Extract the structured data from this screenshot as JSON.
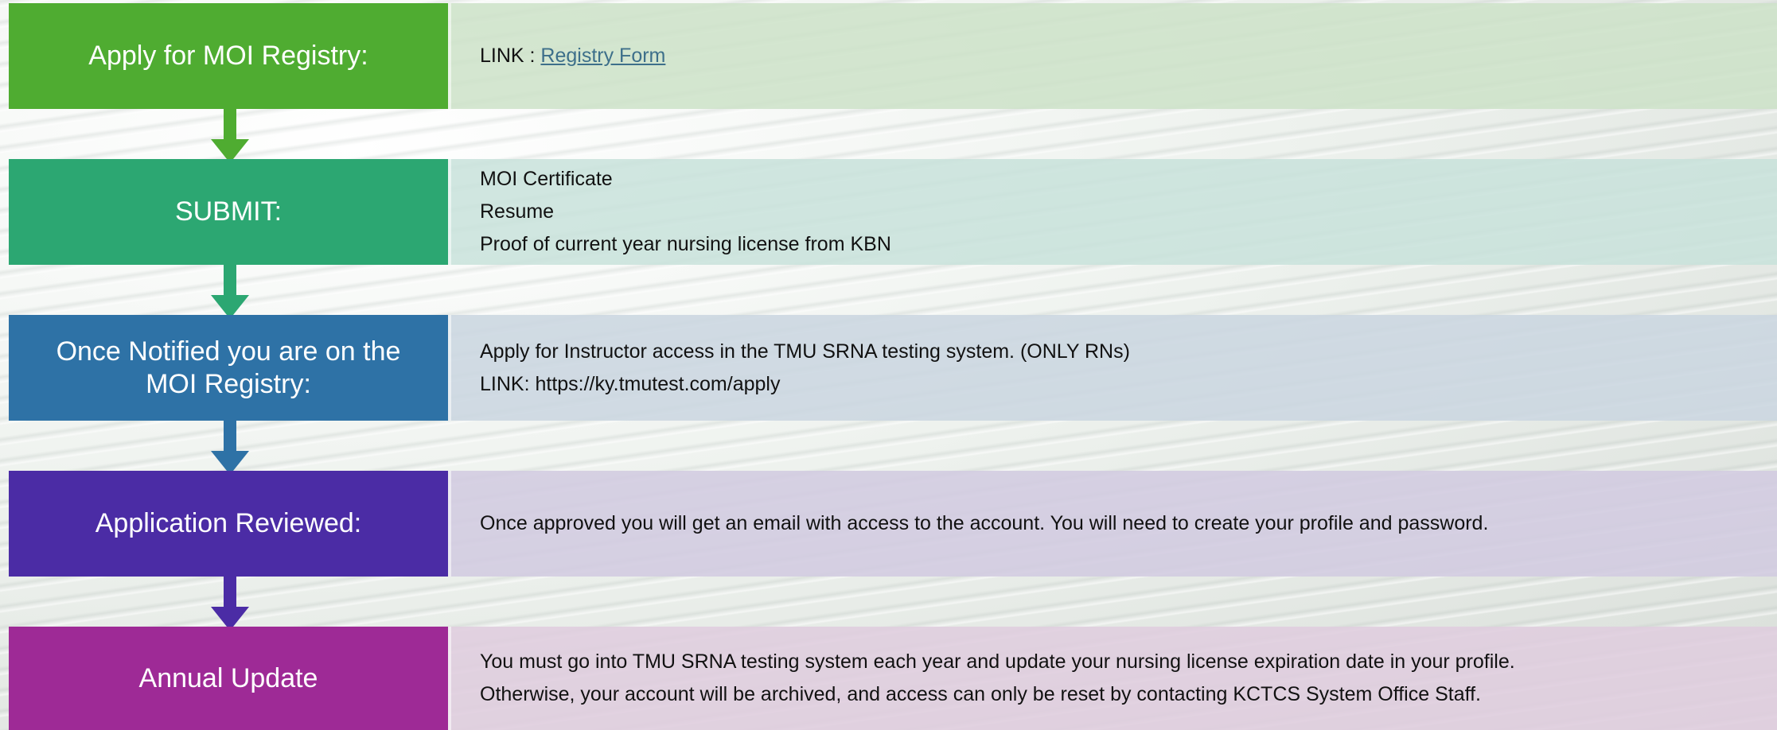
{
  "steps": [
    {
      "title": "Apply for MOI Registry:",
      "color": "#4fac31",
      "bg": "rgba(205,226,200,0.85)",
      "lines": [
        {
          "prefix": "LINK : ",
          "link": "Registry Form"
        }
      ]
    },
    {
      "title": "SUBMIT:",
      "color": "#2ca772",
      "bg": "rgba(200,226,218,0.85)",
      "lines": [
        {
          "text": "MOI Certificate"
        },
        {
          "text": "Resume"
        },
        {
          "text": "Proof of current year nursing license from KBN"
        }
      ]
    },
    {
      "title": "Once Notified you are on the MOI Registry:",
      "color": "#2e72a6",
      "bg": "rgba(203,214,224,0.88)",
      "lines": [
        {
          "text": "Apply for Instructor access in the TMU SRNA testing system. (ONLY RNs)"
        },
        {
          "text": "LINK: https://ky.tmutest.com/apply"
        }
      ]
    },
    {
      "title": "Application Reviewed:",
      "color": "#4b2ca5",
      "bg": "rgba(210,203,224,0.88)",
      "lines": [
        {
          "text": "Once approved you will get an email with access to the account.  You will need to create your profile and password."
        }
      ]
    },
    {
      "title": "Annual Update",
      "color": "#9e2a96",
      "bg": "rgba(223,205,222,0.88)",
      "lines": [
        {
          "text": "You must go into TMU SRNA testing system each year and update your nursing license expiration date in your profile."
        },
        {
          "text": "Otherwise, your account will be archived, and access can only be reset by contacting KCTCS System Office Staff."
        }
      ]
    }
  ]
}
